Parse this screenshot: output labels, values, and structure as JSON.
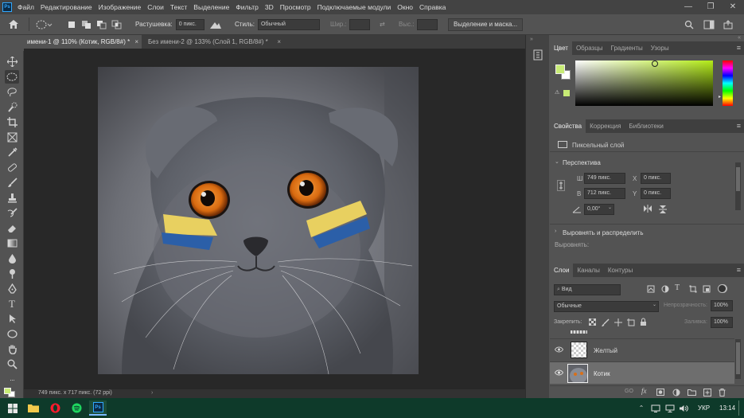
{
  "app": {
    "logo": "Ps",
    "window_controls": [
      "—",
      "❐",
      "✕"
    ]
  },
  "menu": [
    "Файл",
    "Редактирование",
    "Изображение",
    "Слои",
    "Текст",
    "Выделение",
    "Фильтр",
    "3D",
    "Просмотр",
    "Подключаемые модули",
    "Окно",
    "Справка"
  ],
  "options": {
    "feather_label": "Растушевка:",
    "feather_value": "0 пикс.",
    "style_label": "Стиль:",
    "style_value": "Обычный",
    "width_label": "Шир.:",
    "height_label": "Выс.:",
    "select_mask_button": "Выделение и маска..."
  },
  "tabs": [
    {
      "label": "имени-1 @ 110% (Котик, RGB/8#) *",
      "close": "×",
      "active": true
    },
    {
      "label": "Без имени-2 @ 133% (Слой 1, RGB/8#) *",
      "close": "×",
      "active": false
    }
  ],
  "status": "749 пикс. x 717 пикс. (72 ppi)",
  "color_panel": {
    "tabs": [
      "Цвет",
      "Образцы",
      "Градиенты",
      "Узоры"
    ],
    "foreground": "#c8ec76",
    "background": "#ffffff"
  },
  "properties_panel": {
    "tabs": [
      "Свойства",
      "Коррекция",
      "Библиотеки"
    ],
    "layer_type": "Пиксельный слой",
    "transform_title": "Перспектива",
    "w_label": "Ш",
    "w_value": "749 пикс.",
    "x_label": "X",
    "x_value": "0 пикс.",
    "h_label": "В",
    "h_value": "712 пикс.",
    "y_label": "Y",
    "y_value": "0 пикс.",
    "angle_value": "0,00°",
    "align_title": "Выровнять и распределить",
    "align_label": "Выровнять:"
  },
  "layers_panel": {
    "tabs": [
      "Слои",
      "Каналы",
      "Контуры"
    ],
    "filter_value": "Вид",
    "blend_mode": "Обычные",
    "opacity_label": "Непрозрачность:",
    "opacity_value": "100%",
    "lock_label": "Закрепить:",
    "fill_label": "Заливка:",
    "fill_value": "100%",
    "layers": [
      {
        "name": "Желтый",
        "selected": false
      },
      {
        "name": "Котик",
        "selected": true
      }
    ]
  },
  "taskbar": {
    "language": "УКР",
    "time": "13:14"
  },
  "colors": {
    "accent": "#31a8ff",
    "panel_bg": "#535353",
    "canvas_bg": "#282828",
    "paint_yellow": "#e8d060",
    "paint_blue": "#2b5fa8"
  }
}
